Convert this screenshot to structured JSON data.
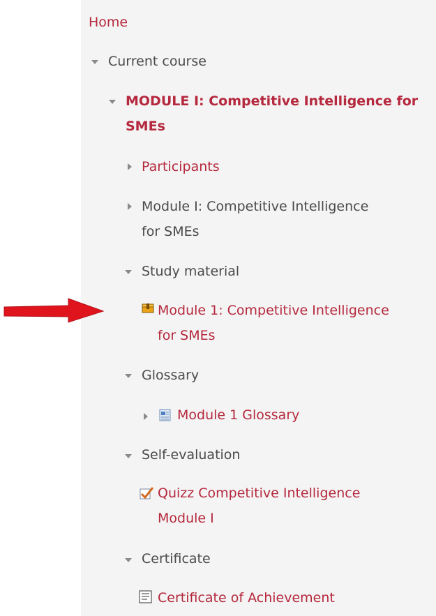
{
  "nav": {
    "home": "Home",
    "current_course": "Current course",
    "course_title_line1": "MODULE I: Competitive Intelligence for",
    "course_title_line2": "SMEs",
    "participants": "Participants",
    "module_section_line1": "Module I: Competitive Intelligence",
    "module_section_line2": "for SMEs",
    "study_material": "Study material",
    "study_resource_line1": "Module 1: Competitive Intelligence",
    "study_resource_line2": "for SMEs",
    "glossary": "Glossary",
    "glossary_item": "Module 1 Glossary",
    "self_evaluation": "Self-evaluation",
    "quiz_line1": "Quizz Competitive Intelligence",
    "quiz_line2": "Module I",
    "certificate": "Certificate",
    "certificate_item": "Certificate of Achievement"
  },
  "colors": {
    "link": "#b5283d",
    "text": "#4a4a4a",
    "panel_bg": "#f4f4f4",
    "arrow": "#e0141c"
  },
  "icons": {
    "expanded": "triangle-down-icon",
    "collapsed": "triangle-right-icon",
    "resource": "package-icon",
    "glossary": "glossary-icon",
    "quiz": "quiz-check-icon",
    "certificate": "certificate-icon",
    "pointer": "red-arrow-icon"
  }
}
